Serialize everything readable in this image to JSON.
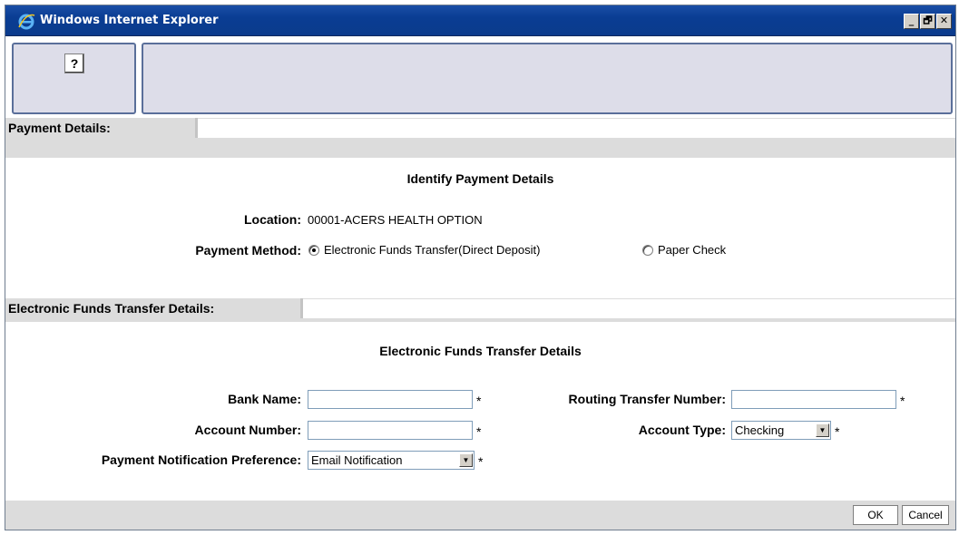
{
  "window": {
    "title": "Windows Internet Explorer",
    "buttons": {
      "minimize": "_",
      "restore": "🗗",
      "close": "✕"
    }
  },
  "toolbar": {
    "help_label": "?"
  },
  "payment_section": {
    "header": "Payment Details:",
    "heading": "Identify Payment Details",
    "location_label": "Location:",
    "location_value": "00001-ACERS HEALTH OPTION",
    "method_label": "Payment Method:",
    "method_options": [
      {
        "label": "Electronic Funds Transfer(Direct Deposit)",
        "checked": true
      },
      {
        "label": "Paper Check",
        "checked": false
      }
    ]
  },
  "eft_section": {
    "header": "Electronic Funds Transfer Details:",
    "heading": "Electronic Funds Transfer Details",
    "bank_name_label": "Bank Name:",
    "bank_name_value": "",
    "account_number_label": "Account Number:",
    "account_number_value": "",
    "notification_label": "Payment Notification Preference:",
    "notification_value": "Email Notification",
    "routing_label": "Routing Transfer Number:",
    "routing_value": "",
    "account_type_label": "Account Type:",
    "account_type_value": "Checking",
    "required_marker": "*"
  },
  "footer": {
    "ok_label": "OK",
    "cancel_label": "Cancel"
  },
  "colors": {
    "titlebar": "#0b3b8c",
    "panel": "#dddde9",
    "band": "#dcdcdc"
  }
}
